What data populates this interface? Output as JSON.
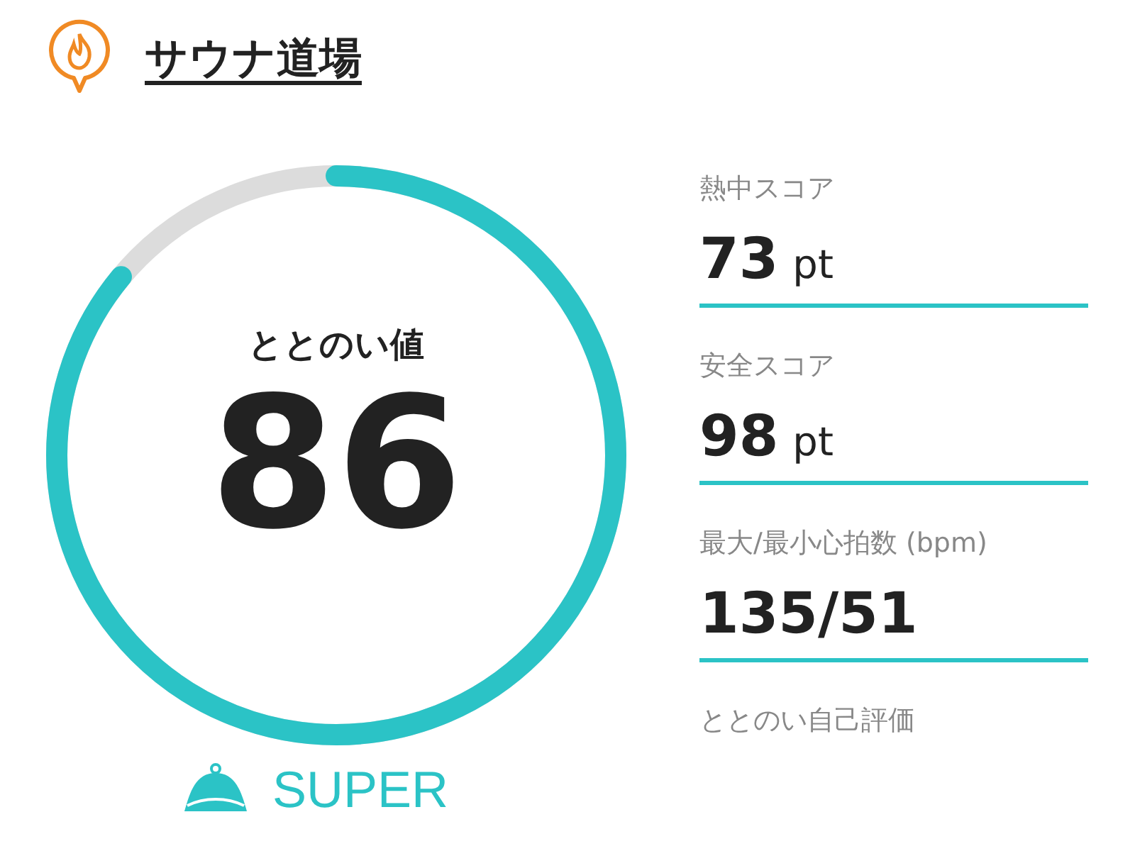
{
  "header": {
    "title": "サウナ道場"
  },
  "gauge": {
    "label": "ととのい値",
    "value": "86",
    "level": 0.86
  },
  "rating": {
    "text": "SUPER"
  },
  "metrics": [
    {
      "label": "熱中スコア",
      "value": "73",
      "unit": "pt"
    },
    {
      "label": "安全スコア",
      "value": "98",
      "unit": "pt"
    },
    {
      "label": "最大/最小心拍数 (bpm)",
      "value": "135/51"
    },
    {
      "label": "ととのい自己評価"
    }
  ]
}
